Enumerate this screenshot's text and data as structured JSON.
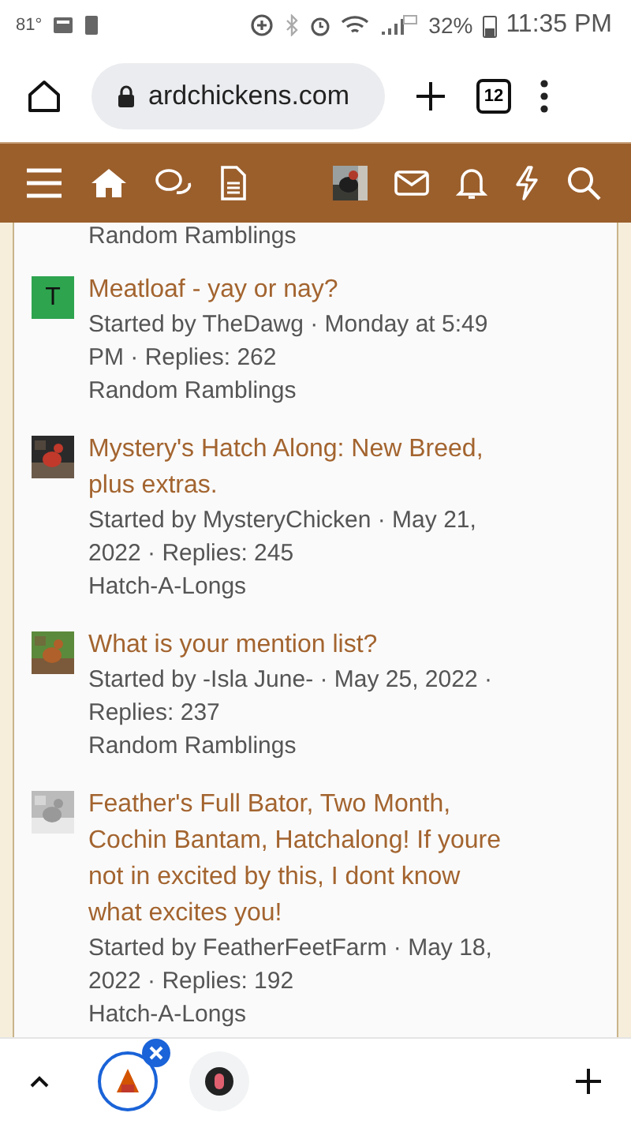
{
  "status_bar": {
    "temperature": "81°",
    "battery": "32%",
    "time": "11:35 PM"
  },
  "browser": {
    "url": "ardchickens.com",
    "tab_count": "12"
  },
  "threads": [
    {
      "category": "Random Ramblings"
    },
    {
      "avatar": {
        "kind": "letter",
        "letter": "T",
        "color": "#2ea44f"
      },
      "title": "Meatloaf - yay or nay?",
      "meta": "Started by TheDawg · Monday at 5:49 PM · Replies: 262",
      "category": "Random Ramblings"
    },
    {
      "title": "Mystery's Hatch Along: New Breed, plus extras.",
      "meta": "Started by MysteryChicken · May 21, 2022 · Replies: 245",
      "category": "Hatch-A-Longs"
    },
    {
      "title": "What is your mention list?",
      "meta": "Started by -Isla June- · May 25, 2022 · Replies: 237",
      "category": "Random Ramblings"
    },
    {
      "title": "Feather's Full Bator, Two Month, Cochin Bantam, Hatchalong! If youre not in excited by this, I dont know what excites you!",
      "meta": "Started by FeatherFeetFarm · May 18, 2022 · Replies: 192",
      "category": "Hatch-A-Longs"
    }
  ],
  "bottom_tabs": [
    {
      "selected": true
    },
    {
      "selected": false
    }
  ]
}
